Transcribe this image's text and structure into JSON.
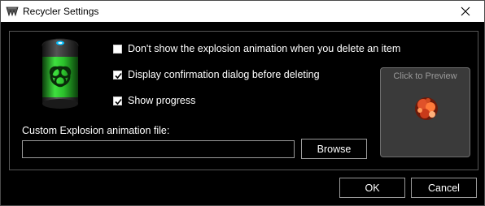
{
  "window": {
    "title": "Recycler Settings",
    "app_icon": "recycler-app-icon",
    "close_icon": "close-icon"
  },
  "options": {
    "hide_explosion": {
      "label": "Don't show the explosion animation when you delete an item",
      "checked": false
    },
    "confirm_dialog": {
      "label": "Display confirmation dialog before deleting",
      "checked": true
    },
    "show_progress": {
      "label": "Show progress",
      "checked": true
    }
  },
  "file": {
    "label": "Custom Explosion animation file:",
    "value": "",
    "browse_label": "Browse"
  },
  "preview": {
    "label": "Click to Preview"
  },
  "buttons": {
    "ok_label": "OK",
    "cancel_label": "Cancel"
  },
  "colors": {
    "background": "#000000",
    "accent_green": "#3fe03f",
    "border": "#9a9a9a"
  }
}
